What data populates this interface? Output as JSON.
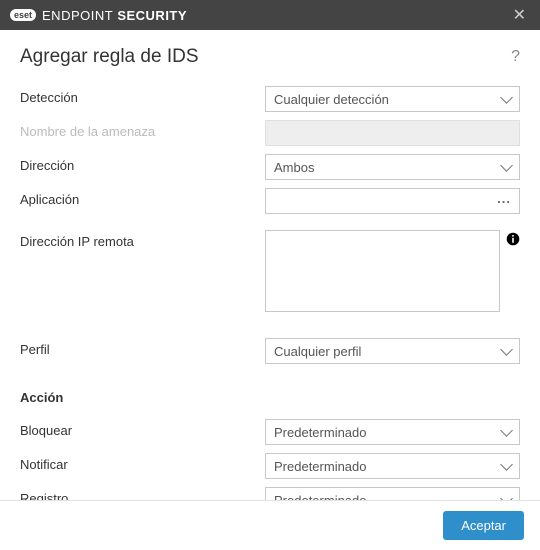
{
  "titlebar": {
    "brand_badge": "eset",
    "brand_text": "ENDPOINT",
    "brand_strong": "SECURITY"
  },
  "header": {
    "title": "Agregar regla de IDS"
  },
  "labels": {
    "deteccion": "Detección",
    "nombre_amenaza": "Nombre de la amenaza",
    "direccion": "Dirección",
    "aplicacion": "Aplicación",
    "direccion_ip": "Dirección IP remota",
    "perfil": "Perfil",
    "accion": "Acción",
    "bloquear": "Bloquear",
    "notificar": "Notificar",
    "registro": "Registro"
  },
  "values": {
    "deteccion": "Cualquier detección",
    "direccion": "Ambos",
    "aplicacion": "",
    "direccion_ip": "",
    "perfil": "Cualquier perfil",
    "bloquear": "Predeterminado",
    "notificar": "Predeterminado",
    "registro": "Predeterminado"
  },
  "buttons": {
    "accept": "Aceptar",
    "browse_dots": "..."
  }
}
